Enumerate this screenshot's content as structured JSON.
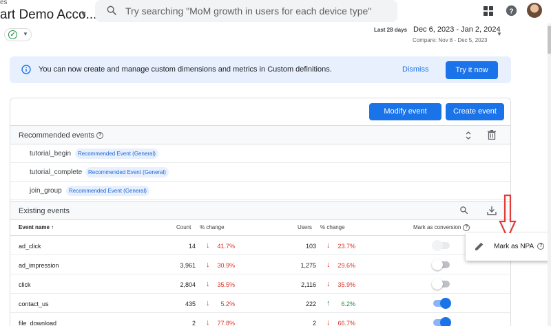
{
  "header": {
    "breadcrumb": "es",
    "account_name": "art Demo Acco...",
    "search_placeholder": "Try searching \"MoM growth in users for each device type\""
  },
  "date": {
    "label": "Last 28 days",
    "range": "Dec 6, 2023 - Jan 2, 2024",
    "compare": "Compare: Nov 8 - Dec 5, 2023"
  },
  "banner": {
    "text": "You can now create and manage custom dimensions and metrics in Custom definitions.",
    "dismiss": "Dismiss",
    "try": "Try it now"
  },
  "toolbar": {
    "modify": "Modify event",
    "create": "Create event"
  },
  "recommended": {
    "title": "Recommended events",
    "items": [
      {
        "name": "tutorial_begin",
        "chip": "Recommended Event (General)"
      },
      {
        "name": "tutorial_complete",
        "chip": "Recommended Event (General)"
      },
      {
        "name": "join_group",
        "chip": "Recommended Event (General)"
      }
    ]
  },
  "existing": {
    "title": "Existing events",
    "columns": {
      "name": "Event name",
      "count": "Count",
      "count_change": "% change",
      "users": "Users",
      "users_change": "% change",
      "conversion": "Mark as conversion"
    },
    "rows": [
      {
        "name": "ad_click",
        "count": "14",
        "count_change": "41.7%",
        "users": "103",
        "users_change": "23.7%"
      },
      {
        "name": "ad_impression",
        "count": "3,961",
        "count_change": "30.9%",
        "users": "1,275",
        "users_change": "29.6%"
      },
      {
        "name": "click",
        "count": "2,804",
        "count_change": "35.5%",
        "users": "2,116",
        "users_change": "35.9%"
      },
      {
        "name": "contact_us",
        "count": "435",
        "count_change": "5.2%",
        "users": "222",
        "users_change": "6.2%"
      },
      {
        "name": "file_download",
        "count": "2",
        "count_change": "77.8%",
        "users": "2",
        "users_change": "66.7%"
      }
    ]
  },
  "menu": {
    "mark_npa": "Mark as NPA"
  },
  "colors": {
    "accent": "#1a73e8",
    "negative": "#d93025",
    "positive": "#1e8e3e",
    "banner_bg": "#e8f0fe",
    "annotation_arrow": "#e53935"
  }
}
